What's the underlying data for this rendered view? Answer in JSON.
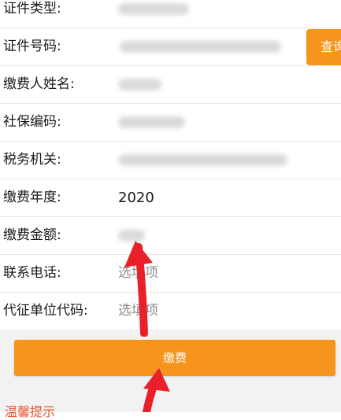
{
  "form": {
    "rows": [
      {
        "label": "证件类型:",
        "value": ""
      },
      {
        "label": "证件号码:",
        "value": ""
      },
      {
        "label": "缴费人姓名:",
        "value": ""
      },
      {
        "label": "社保编码:",
        "value": ""
      },
      {
        "label": "税务机关:",
        "value": ""
      },
      {
        "label": "缴费年度:",
        "value": "2020"
      },
      {
        "label": "缴费金额:",
        "value": ""
      },
      {
        "label": "联系电话:",
        "placeholder": "选填项"
      },
      {
        "label": "代征单位代码:",
        "placeholder": "选填项"
      }
    ]
  },
  "query_button": {
    "label": "查询"
  },
  "pay_button": {
    "label": "缴费"
  },
  "bottom_link": {
    "label": "温馨提示"
  },
  "colors": {
    "accent": "#f6941e",
    "arrow": "#e8202a",
    "link": "#e8572e"
  }
}
